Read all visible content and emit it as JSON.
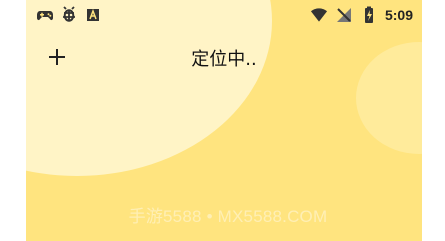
{
  "status_bar": {
    "left_icons": [
      "game-controller-icon",
      "bug-icon",
      "font-icon"
    ],
    "right_icons": [
      "wifi-icon",
      "no-signal-icon",
      "battery-charging-icon"
    ],
    "time": "5:09"
  },
  "app_bar": {
    "add_icon": "plus-icon",
    "title": "定位中.."
  },
  "watermark": {
    "text": "手游5588 • MX5588.COM"
  },
  "colors": {
    "background": "#ffe47f",
    "large_circle": "#fff4c6",
    "small_circle": "#ffeb9b",
    "status_text": "#222222",
    "title_text": "#111111"
  }
}
